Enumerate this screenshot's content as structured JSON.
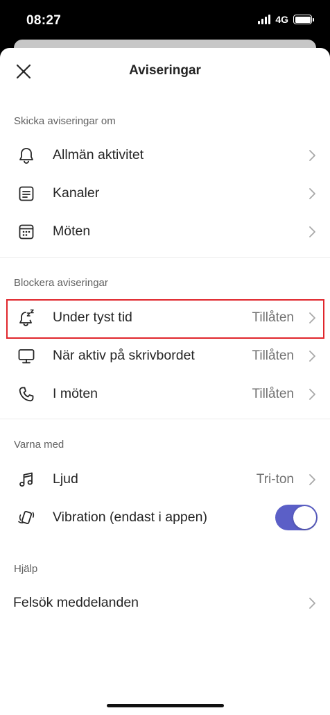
{
  "status_bar": {
    "time": "08:27",
    "network": "4G"
  },
  "nav": {
    "title": "Aviseringar",
    "close_icon": "close-icon"
  },
  "sections": {
    "notify_about": {
      "header": "Skicka aviseringar om",
      "items": [
        {
          "label": "Allmän aktivitet",
          "icon": "bell-icon"
        },
        {
          "label": "Kanaler",
          "icon": "channel-icon"
        },
        {
          "label": "Möten",
          "icon": "calendar-icon"
        }
      ]
    },
    "block": {
      "header": "Blockera aviseringar",
      "items": [
        {
          "label": "Under tyst tid",
          "value": "Tillåten",
          "icon": "snooze-bell-icon",
          "highlighted": true
        },
        {
          "label": "När aktiv på skrivbordet",
          "value": "Tillåten",
          "icon": "desktop-icon"
        },
        {
          "label": "I möten",
          "value": "Tillåten",
          "icon": "phone-icon"
        }
      ]
    },
    "alert_with": {
      "header": "Varna med",
      "items": [
        {
          "label": "Ljud",
          "value": "Tri-ton",
          "icon": "music-note-icon"
        },
        {
          "label": "Vibration (endast i appen)",
          "icon": "vibration-icon",
          "toggle_on": true
        }
      ]
    },
    "help": {
      "header": "Hjälp",
      "items": [
        {
          "label": "Felsök meddelanden"
        }
      ]
    }
  },
  "colors": {
    "accent": "#5b5fc7",
    "highlight": "#e0262c"
  }
}
